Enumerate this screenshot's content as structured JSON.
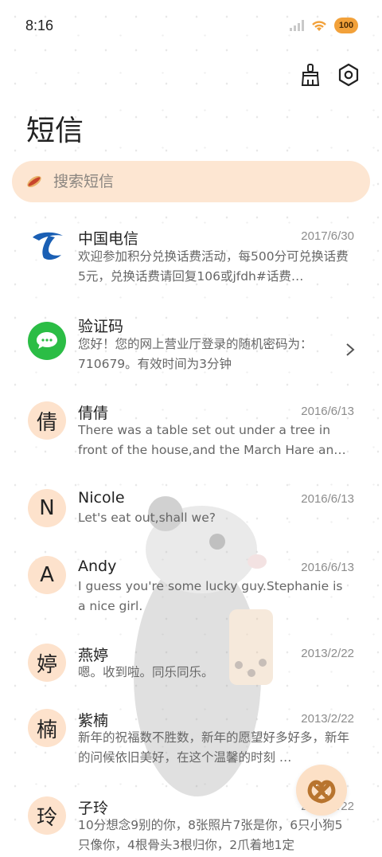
{
  "status_bar": {
    "time": "8:16",
    "battery": "100"
  },
  "page": {
    "title": "短信"
  },
  "search": {
    "placeholder": "搜索短信"
  },
  "conversations": [
    {
      "name": "中国电信",
      "date": "2017/6/30",
      "preview": "欢迎参加积分兑换话费活动，每500分可兑换话费5元，兑换话费请回复106或jfdh#话费…",
      "avatar_text": "",
      "avatar_icon": "china-telecom-logo-icon"
    },
    {
      "name": "验证码",
      "date": "",
      "preview": "您好！您的网上营业厅登录的随机密码为：710679。有效时间为3分钟",
      "avatar_text": "",
      "avatar_icon": "chat-bubble-icon"
    },
    {
      "name": "倩倩",
      "date": "2016/6/13",
      "preview": "There was a table set out under a tree in front of the house,and the March Hare an…",
      "avatar_text": "倩"
    },
    {
      "name": "Nicole",
      "date": "2016/6/13",
      "preview": "Let's eat out,shall we?",
      "avatar_text": "N"
    },
    {
      "name": "Andy",
      "date": "2016/6/13",
      "preview": "I guess you're some lucky guy.Stephanie is a nice girl.",
      "avatar_text": "A"
    },
    {
      "name": "燕婷",
      "date": "2013/2/22",
      "preview": "嗯。收到啦。同乐同乐。",
      "avatar_text": "婷"
    },
    {
      "name": "紫楠",
      "date": "2013/2/22",
      "preview": "新年的祝福数不胜数，新年的愿望好多好多，新年的问候依旧美好，在这个温馨的时刻 …",
      "avatar_text": "楠"
    },
    {
      "name": "子玲",
      "date": "2013/2/22",
      "preview": "10分想念9别的你，8张照片7张是你，6只小狗5只像你，4根骨头3根归你，2爪着地1定",
      "avatar_text": "玲"
    }
  ],
  "colors": {
    "accent": "#fde6d2",
    "avatar_bg": "#fde2cc",
    "telecom_blue": "#1a5fb4",
    "chat_green": "#2bbd45"
  }
}
